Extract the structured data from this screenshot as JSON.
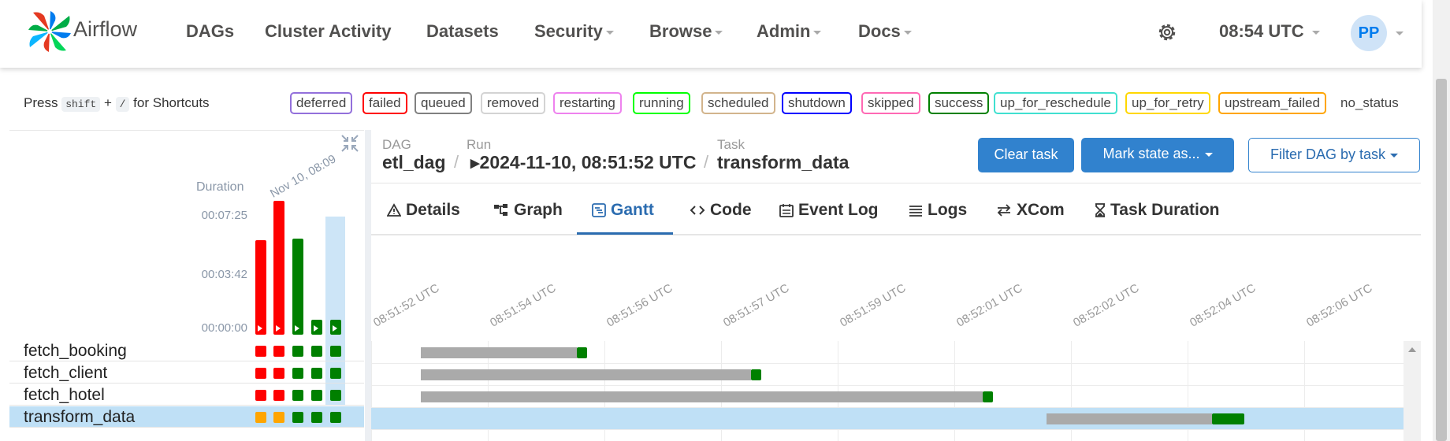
{
  "navbar": {
    "brand": "Airflow",
    "menu": [
      {
        "label": "DAGs",
        "dropdown": false
      },
      {
        "label": "Cluster Activity",
        "dropdown": false
      },
      {
        "label": "Datasets",
        "dropdown": false
      },
      {
        "label": "Security",
        "dropdown": true
      },
      {
        "label": "Browse",
        "dropdown": true
      },
      {
        "label": "Admin",
        "dropdown": true
      },
      {
        "label": "Docs",
        "dropdown": true
      }
    ],
    "clock": "08:54 UTC",
    "user_initials": "PP",
    "settings_icon": "gear-icon"
  },
  "shortcuts": {
    "press": "Press",
    "key1": "shift",
    "plus": "+",
    "key2": "/",
    "suffix": "for Shortcuts"
  },
  "legend": [
    {
      "label": "deferred",
      "color": "#9370db"
    },
    {
      "label": "failed",
      "color": "#ff0000"
    },
    {
      "label": "queued",
      "color": "#808080"
    },
    {
      "label": "removed",
      "color": "#d3d3d3"
    },
    {
      "label": "restarting",
      "color": "#ee82ee"
    },
    {
      "label": "running",
      "color": "#00ff00"
    },
    {
      "label": "scheduled",
      "color": "#d2b48c"
    },
    {
      "label": "shutdown",
      "color": "#0000ff"
    },
    {
      "label": "skipped",
      "color": "#ff69b4"
    },
    {
      "label": "success",
      "color": "#008000"
    },
    {
      "label": "up_for_reschedule",
      "color": "#40e0d0"
    },
    {
      "label": "up_for_retry",
      "color": "#ffd700"
    },
    {
      "label": "upstream_failed",
      "color": "#ffa500"
    }
  ],
  "no_status_label": "no_status",
  "grid": {
    "duration_label": "Duration",
    "run_date_label": "Nov 10, 08:09",
    "y_ticks": [
      "00:07:25",
      "00:03:42",
      "00:00:00"
    ],
    "runs": [
      {
        "duration_fraction": 0.75,
        "state": "failed"
      },
      {
        "duration_fraction": 1.06,
        "state": "failed"
      },
      {
        "duration_fraction": 0.76,
        "state": "success"
      },
      {
        "duration_fraction": 0.12,
        "state": "success"
      },
      {
        "duration_fraction": 0.12,
        "state": "success",
        "selected": true
      }
    ],
    "tasks": [
      {
        "name": "fetch_booking",
        "states": [
          "failed",
          "failed",
          "success",
          "success",
          "success"
        ]
      },
      {
        "name": "fetch_client",
        "states": [
          "failed",
          "failed",
          "success",
          "success",
          "success"
        ]
      },
      {
        "name": "fetch_hotel",
        "states": [
          "failed",
          "failed",
          "success",
          "success",
          "success"
        ]
      },
      {
        "name": "transform_data",
        "states": [
          "upstream_failed",
          "upstream_failed",
          "success",
          "success",
          "success"
        ],
        "selected": true
      }
    ]
  },
  "breadcrumb": {
    "dag_key": "DAG",
    "dag_value": "etl_dag",
    "run_key": "Run",
    "run_value": "2024-11-10, 08:51:52 UTC",
    "task_key": "Task",
    "task_value": "transform_data",
    "separator": "/"
  },
  "actions": {
    "clear_task": "Clear task",
    "mark_state": "Mark state as...",
    "filter_dag": "Filter DAG by task"
  },
  "tabs": [
    {
      "label": "Details",
      "icon": "warning-triangle-icon"
    },
    {
      "label": "Graph",
      "icon": "graph-icon"
    },
    {
      "label": "Gantt",
      "icon": "gantt-icon",
      "active": true
    },
    {
      "label": "Code",
      "icon": "code-icon"
    },
    {
      "label": "Event Log",
      "icon": "calendar-icon"
    },
    {
      "label": "Logs",
      "icon": "list-icon"
    },
    {
      "label": "XCom",
      "icon": "arrows-icon"
    },
    {
      "label": "Task Duration",
      "icon": "hourglass-icon"
    }
  ],
  "gantt": {
    "axis_ticks": [
      "08:51:52 UTC",
      "08:51:54 UTC",
      "08:51:56 UTC",
      "08:51:57 UTC",
      "08:51:59 UTC",
      "08:52:01 UTC",
      "08:52:02 UTC",
      "08:52:04 UTC",
      "08:52:06 UTC"
    ],
    "axis_start_seconds": 0,
    "axis_end_seconds": 17.8,
    "rows": [
      {
        "task": "fetch_booking",
        "queued_start": 0.85,
        "run_start": 3.55,
        "end": 3.72,
        "state": "success"
      },
      {
        "task": "fetch_client",
        "queued_start": 0.85,
        "run_start": 6.55,
        "end": 6.72,
        "state": "success"
      },
      {
        "task": "fetch_hotel",
        "queued_start": 0.85,
        "run_start": 10.55,
        "end": 10.72,
        "state": "success"
      },
      {
        "task": "transform_data",
        "queued_start": 11.65,
        "run_start": 14.5,
        "end": 15.05,
        "state": "success",
        "selected": true
      }
    ]
  },
  "state_colors": {
    "failed": "#ff0000",
    "success": "#008000",
    "upstream_failed": "#ffa500",
    "queued": "#aaaaaa"
  }
}
